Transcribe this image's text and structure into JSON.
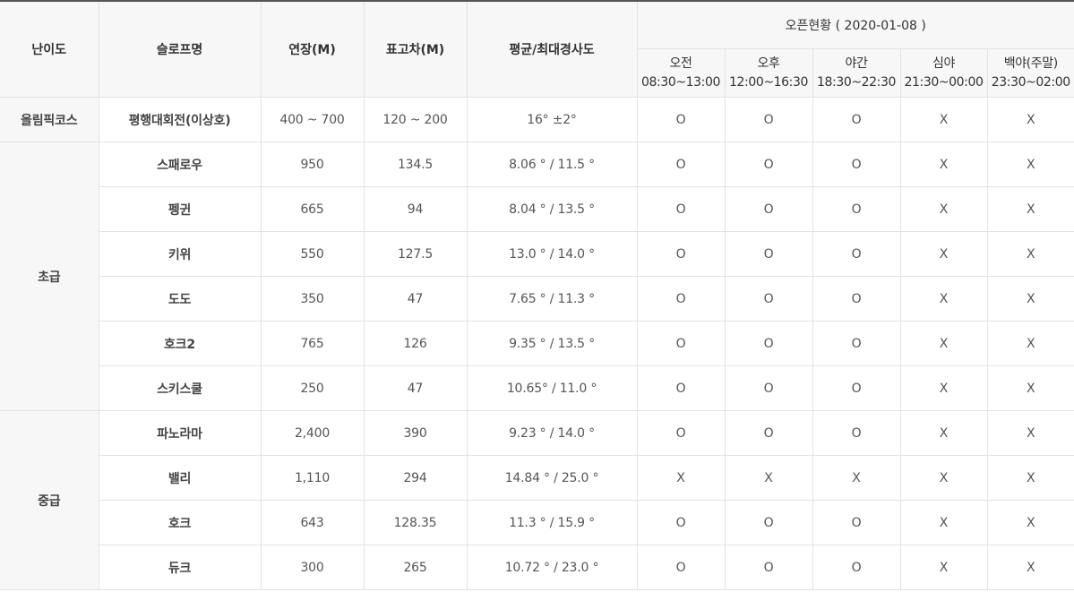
{
  "header": {
    "level": "난이도",
    "slope_name": "슬로프명",
    "length": "연장(M)",
    "elevation": "표고차(M)",
    "gradient": "평균/최대경사도",
    "open_status": "오픈현황 ( 2020-01-08 )",
    "sessions": [
      {
        "name": "오전",
        "time": "08:30~13:00"
      },
      {
        "name": "오후",
        "time": "12:00~16:30"
      },
      {
        "name": "야간",
        "time": "18:30~22:30"
      },
      {
        "name": "심야",
        "time": "21:30~00:00"
      },
      {
        "name": "백야(주말)",
        "time": "23:30~02:00"
      }
    ]
  },
  "groups": [
    {
      "level": "올림픽코스",
      "rows": [
        {
          "name": "평행대회전(이상호)",
          "length": "400 ~ 700",
          "elevation": "120 ~ 200",
          "gradient": "16° ±2°",
          "status": [
            "O",
            "O",
            "O",
            "X",
            "X"
          ]
        }
      ]
    },
    {
      "level": "초급",
      "rows": [
        {
          "name": "스패로우",
          "length": "950",
          "elevation": "134.5",
          "gradient": "8.06 ° / 11.5 °",
          "status": [
            "O",
            "O",
            "O",
            "X",
            "X"
          ]
        },
        {
          "name": "펭귄",
          "length": "665",
          "elevation": "94",
          "gradient": "8.04 ° / 13.5 °",
          "status": [
            "O",
            "O",
            "O",
            "X",
            "X"
          ]
        },
        {
          "name": "키위",
          "length": "550",
          "elevation": "127.5",
          "gradient": "13.0 ° / 14.0 °",
          "status": [
            "O",
            "O",
            "O",
            "X",
            "X"
          ]
        },
        {
          "name": "도도",
          "length": "350",
          "elevation": "47",
          "gradient": "7.65 ° / 11.3 °",
          "status": [
            "O",
            "O",
            "O",
            "X",
            "X"
          ]
        },
        {
          "name": "호크2",
          "length": "765",
          "elevation": "126",
          "gradient": "9.35 ° / 13.5 °",
          "status": [
            "O",
            "O",
            "O",
            "X",
            "X"
          ]
        },
        {
          "name": "스키스쿨",
          "length": "250",
          "elevation": "47",
          "gradient": "10.65° / 11.0 °",
          "status": [
            "O",
            "O",
            "O",
            "X",
            "X"
          ]
        }
      ]
    },
    {
      "level": "중급",
      "rows": [
        {
          "name": "파노라마",
          "length": "2,400",
          "elevation": "390",
          "gradient": "9.23 ° / 14.0 °",
          "status": [
            "O",
            "O",
            "O",
            "X",
            "X"
          ]
        },
        {
          "name": "밸리",
          "length": "1,110",
          "elevation": "294",
          "gradient": "14.84 ° / 25.0 °",
          "status": [
            "X",
            "X",
            "X",
            "X",
            "X"
          ]
        },
        {
          "name": "호크",
          "length": "643",
          "elevation": "128.35",
          "gradient": "11.3 ° / 15.9 °",
          "status": [
            "O",
            "O",
            "O",
            "X",
            "X"
          ]
        },
        {
          "name": "듀크",
          "length": "300",
          "elevation": "265",
          "gradient": "10.72 ° / 23.0 °",
          "status": [
            "O",
            "O",
            "O",
            "X",
            "X"
          ]
        }
      ]
    }
  ]
}
